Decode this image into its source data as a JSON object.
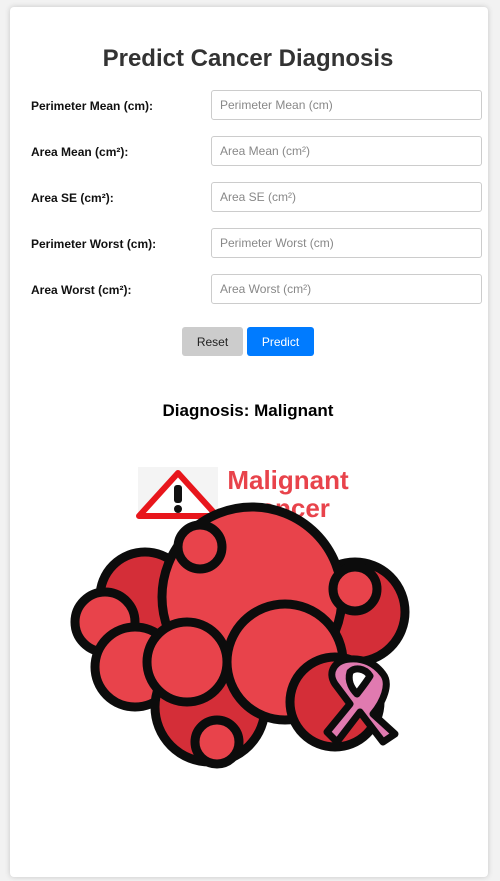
{
  "title": "Predict Cancer Diagnosis",
  "fields": [
    {
      "label": "Perimeter Mean (cm):",
      "placeholder": "Perimeter Mean (cm)",
      "value": ""
    },
    {
      "label": "Area Mean (cm²):",
      "placeholder": "Area Mean (cm²)",
      "value": ""
    },
    {
      "label": "Area SE (cm²):",
      "placeholder": "Area SE (cm²)",
      "value": ""
    },
    {
      "label": "Perimeter Worst (cm):",
      "placeholder": "Perimeter Worst (cm)",
      "value": ""
    },
    {
      "label": "Area Worst (cm²):",
      "placeholder": "Area Worst (cm²)",
      "value": ""
    }
  ],
  "buttons": {
    "reset": "Reset",
    "predict": "Predict"
  },
  "result": {
    "diagnosis_text": "Diagnosis: Malignant"
  },
  "illustration": {
    "line1": "Malignant",
    "line2": "cancer",
    "icons": [
      "warning-icon",
      "tumor-cells-icon",
      "awareness-ribbon-icon"
    ]
  },
  "colors": {
    "accent": "#007bff",
    "reset_button": "#cccccc",
    "tumor_red": "#e8434b",
    "tumor_dark": "#b7242d",
    "ribbon_pink": "#e07ab0",
    "heading_red": "#e8434b"
  }
}
